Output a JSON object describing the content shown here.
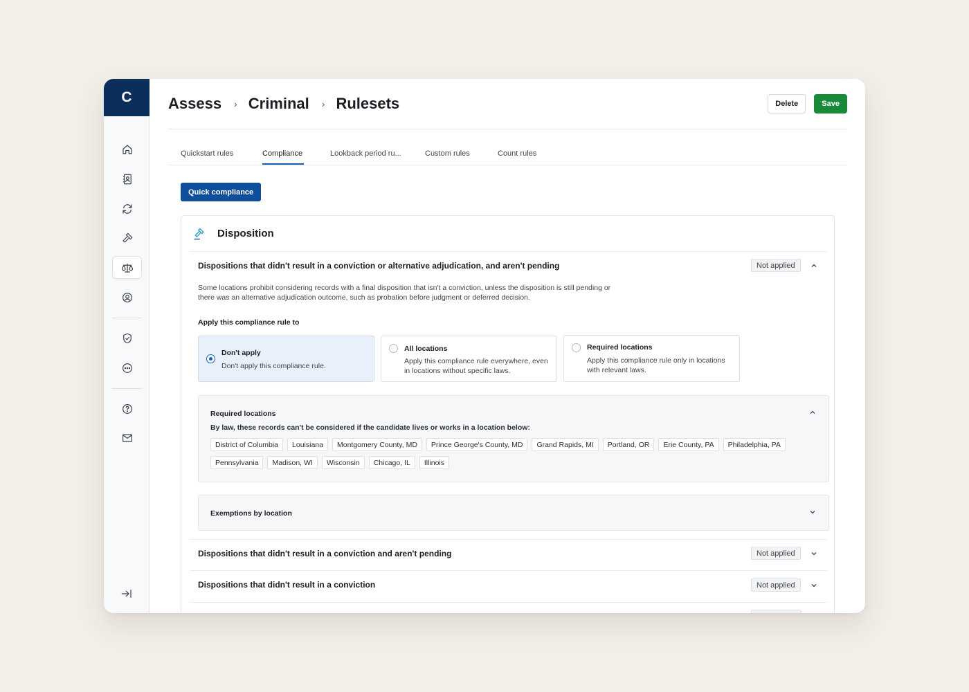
{
  "sidebar": {
    "logo": "C",
    "items": [
      {
        "icon": "home-icon"
      },
      {
        "icon": "contacts-icon"
      },
      {
        "icon": "refresh-icon"
      },
      {
        "icon": "gavel-icon"
      },
      {
        "icon": "scales-icon",
        "active": true
      },
      {
        "icon": "user-circle-icon"
      },
      {
        "icon": "shield-check-icon"
      },
      {
        "icon": "more-circle-icon"
      },
      {
        "icon": "help-icon"
      },
      {
        "icon": "mail-icon"
      }
    ],
    "collapse_icon": "collapse-arrow-icon"
  },
  "breadcrumb": [
    "Assess",
    "Criminal",
    "Rulesets"
  ],
  "actions": {
    "delete_label": "Delete",
    "save_label": "Save"
  },
  "tabs": [
    {
      "label": "Quickstart rules"
    },
    {
      "label": "Compliance",
      "active": true
    },
    {
      "label": "Lookback period ru..."
    },
    {
      "label": "Custom rules"
    },
    {
      "label": "Count rules"
    }
  ],
  "quick_compliance_label": "Quick compliance",
  "section": {
    "title": "Disposition",
    "rules": [
      {
        "title": "Dispositions that didn't result in a conviction or alternative adjudication, and aren't pending",
        "status": "Not applied",
        "expanded": true
      },
      {
        "title": "Dispositions that didn't result in a conviction and aren't pending",
        "status": "Not applied"
      },
      {
        "title": "Dispositions that didn't result in a conviction",
        "status": "Not applied"
      }
    ],
    "description": "Some locations prohibit considering records with a final disposition that isn't a conviction, unless the disposition is still pending or there was an alternative adjudication outcome, such as probation before judgment or deferred decision.",
    "apply_label": "Apply this compliance rule to",
    "options": [
      {
        "title": "Don't apply",
        "desc": "Don't apply this compliance rule.",
        "selected": true
      },
      {
        "title": "All locations",
        "desc": "Apply this compliance rule everywhere, even in locations without specific laws."
      },
      {
        "title": "Required locations",
        "desc": "Apply this compliance rule only in locations with relevant laws."
      }
    ],
    "required_panel": {
      "title": "Required locations",
      "subtitle": "By law, these records can't be considered if the candidate lives or works in a location below:",
      "locations": [
        "District of Columbia",
        "Louisiana",
        "Montgomery County, MD",
        "Prince George's County, MD",
        "Grand Rapids, MI",
        "Portland, OR",
        "Erie County, PA",
        "Philadelphia, PA",
        "Pennsylvania",
        "Madison, WI",
        "Wisconsin",
        "Chicago, IL",
        "Illinois"
      ]
    },
    "exemptions_panel": {
      "title": "Exemptions by location"
    }
  },
  "colors": {
    "brand_navy": "#0b2e5b",
    "primary_blue": "#0d4f9a",
    "save_green": "#1a8a3a",
    "accent_teal": "#2a9cc0"
  }
}
